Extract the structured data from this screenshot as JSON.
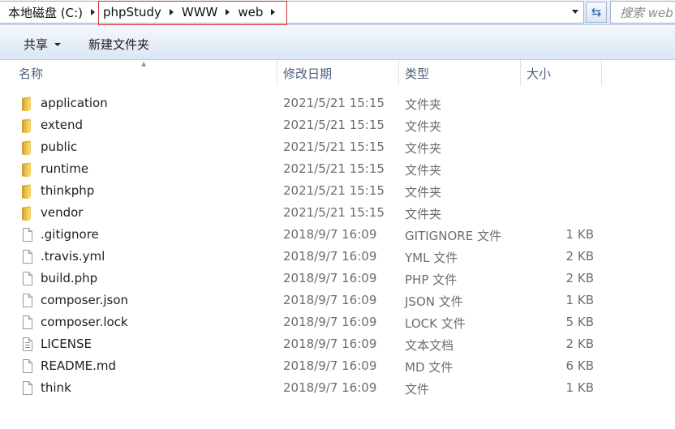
{
  "address_bar": {
    "crumbs": [
      "本地磁盘 (C:)",
      "phpStudy",
      "WWW",
      "web"
    ],
    "search_placeholder": "搜索 web"
  },
  "toolbar": {
    "share_label": "共享",
    "new_folder_label": "新建文件夹"
  },
  "columns": {
    "name": "名称",
    "modified": "修改日期",
    "type": "类型",
    "size": "大小"
  },
  "files": [
    {
      "name": "application",
      "date": "2021/5/21 15:15",
      "type": "文件夹",
      "size": "",
      "icon": "folder-icon"
    },
    {
      "name": "extend",
      "date": "2021/5/21 15:15",
      "type": "文件夹",
      "size": "",
      "icon": "folder-icon"
    },
    {
      "name": "public",
      "date": "2021/5/21 15:15",
      "type": "文件夹",
      "size": "",
      "icon": "folder-icon"
    },
    {
      "name": "runtime",
      "date": "2021/5/21 15:15",
      "type": "文件夹",
      "size": "",
      "icon": "folder-icon"
    },
    {
      "name": "thinkphp",
      "date": "2021/5/21 15:15",
      "type": "文件夹",
      "size": "",
      "icon": "folder-icon"
    },
    {
      "name": "vendor",
      "date": "2021/5/21 15:15",
      "type": "文件夹",
      "size": "",
      "icon": "folder-icon"
    },
    {
      "name": ".gitignore",
      "date": "2018/9/7 16:09",
      "type": "GITIGNORE 文件",
      "size": "1 KB",
      "icon": "file-icon"
    },
    {
      "name": ".travis.yml",
      "date": "2018/9/7 16:09",
      "type": "YML 文件",
      "size": "2 KB",
      "icon": "file-icon"
    },
    {
      "name": "build.php",
      "date": "2018/9/7 16:09",
      "type": "PHP 文件",
      "size": "2 KB",
      "icon": "file-icon"
    },
    {
      "name": "composer.json",
      "date": "2018/9/7 16:09",
      "type": "JSON 文件",
      "size": "1 KB",
      "icon": "file-icon"
    },
    {
      "name": "composer.lock",
      "date": "2018/9/7 16:09",
      "type": "LOCK 文件",
      "size": "5 KB",
      "icon": "file-icon"
    },
    {
      "name": "LICENSE",
      "date": "2018/9/7 16:09",
      "type": "文本文档",
      "size": "2 KB",
      "icon": "text-file-icon"
    },
    {
      "name": "README.md",
      "date": "2018/9/7 16:09",
      "type": "MD 文件",
      "size": "6 KB",
      "icon": "file-icon"
    },
    {
      "name": "think",
      "date": "2018/9/7 16:09",
      "type": "文件",
      "size": "1 KB",
      "icon": "file-icon"
    }
  ],
  "colors": {
    "highlight_border": "#e0303a",
    "header_text": "#4c607a",
    "detail_text": "#6d6d6d"
  }
}
